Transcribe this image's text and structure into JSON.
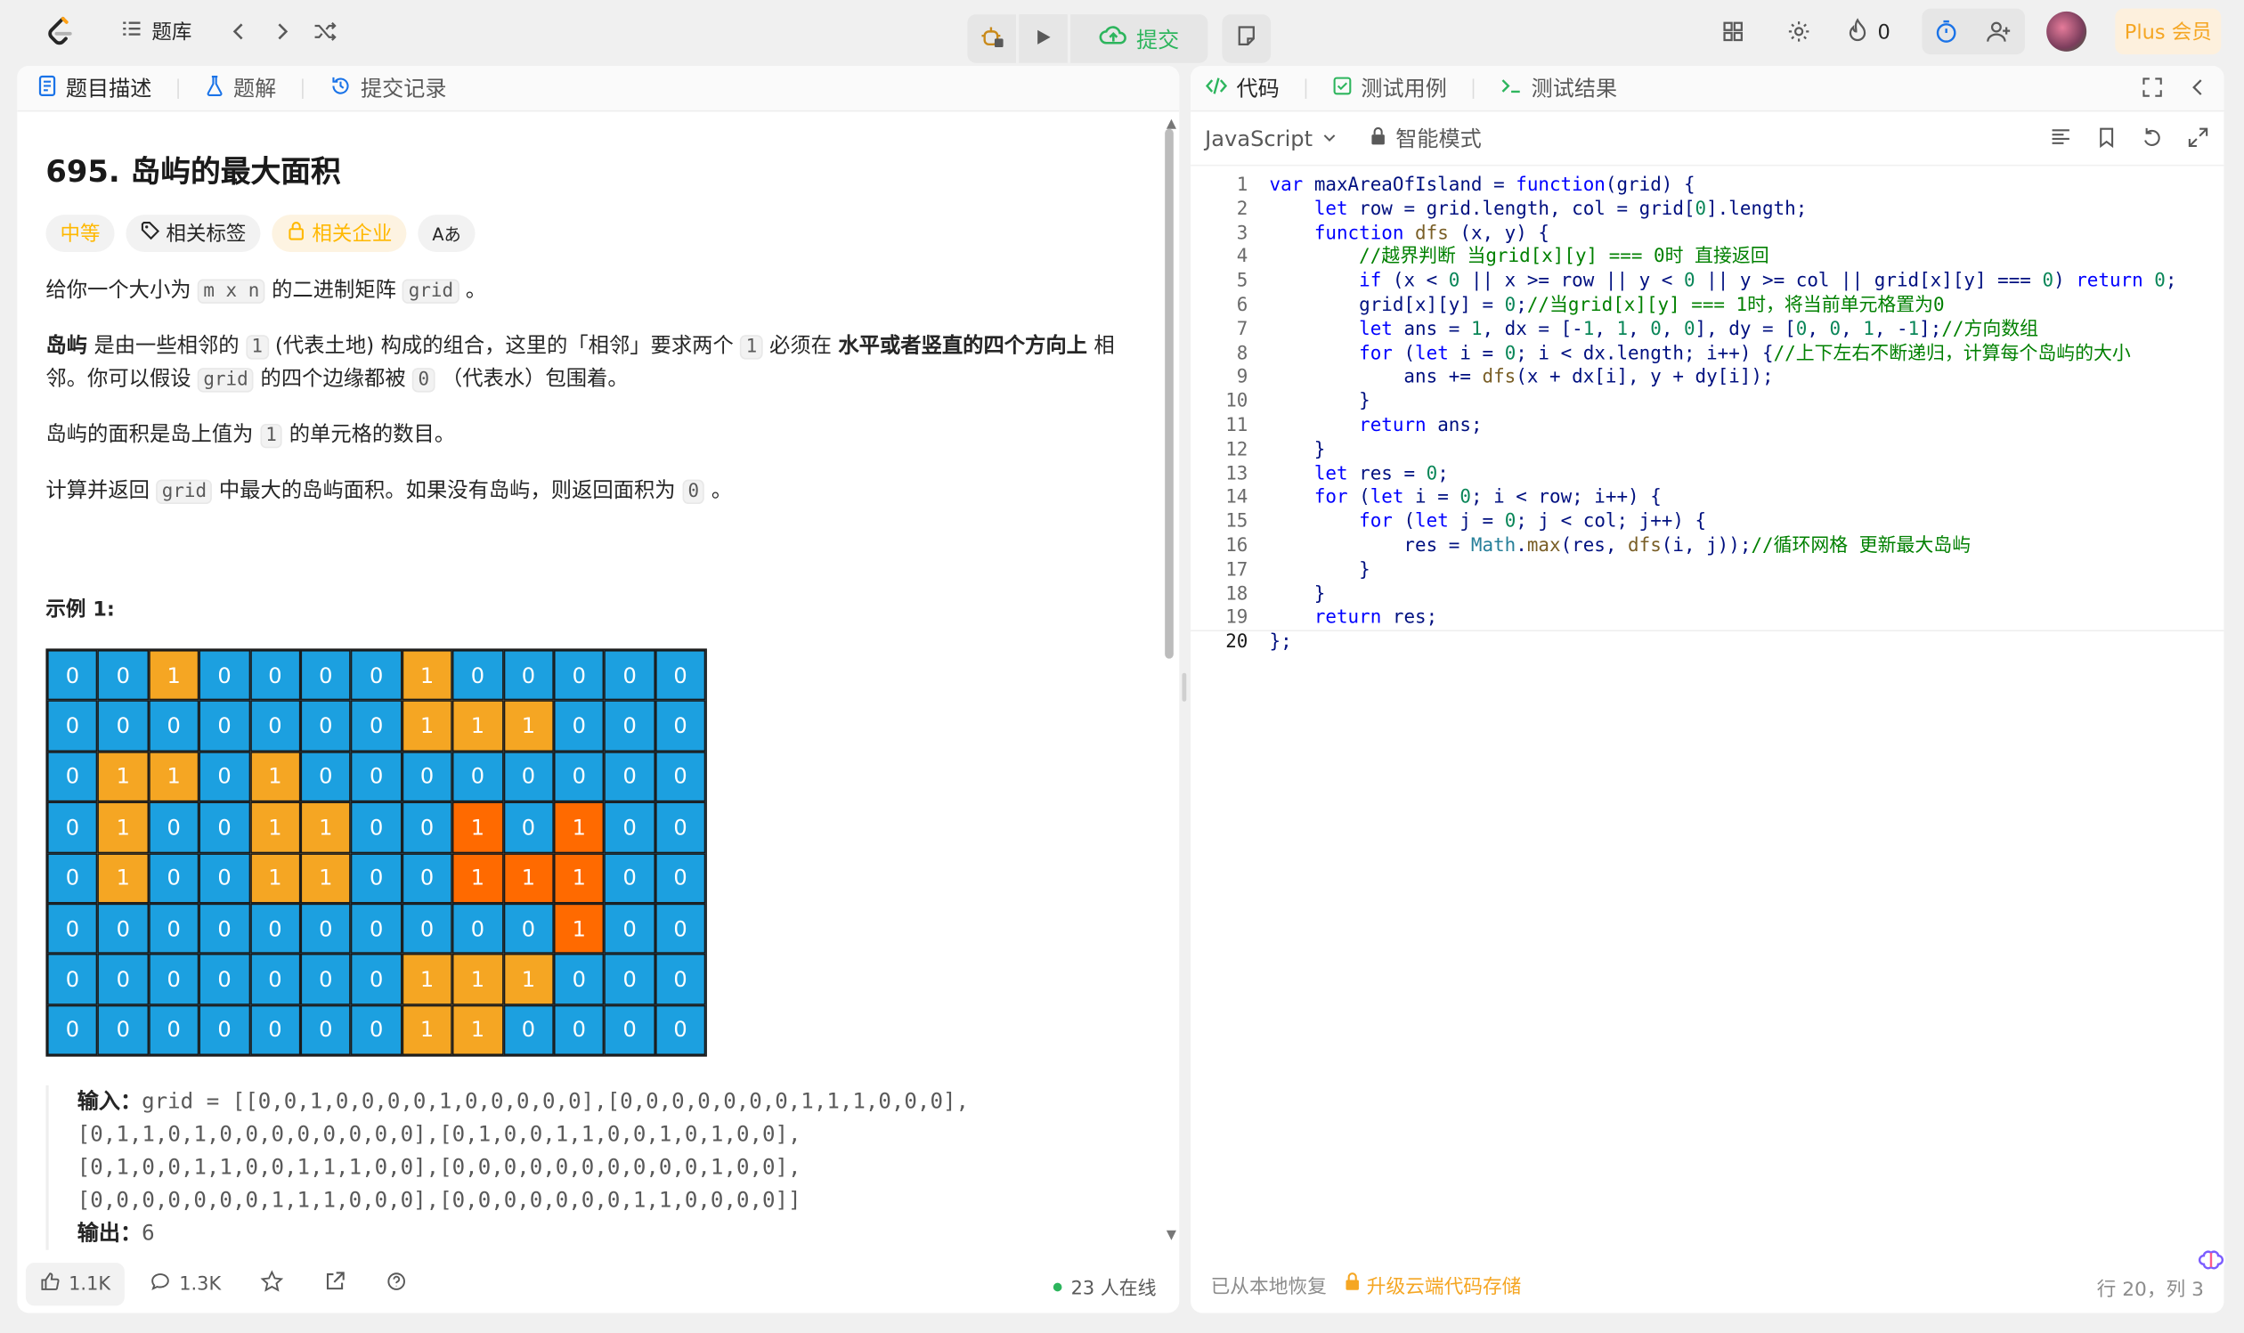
{
  "topbar": {
    "nav_label": "题库",
    "streak_count": "0",
    "plus_label": "Plus 会员",
    "submit_label": "提交"
  },
  "left_tabs": [
    {
      "label": "题目描述"
    },
    {
      "label": "题解"
    },
    {
      "label": "提交记录"
    }
  ],
  "problem": {
    "title": "695. 岛屿的最大面积",
    "difficulty": "中等",
    "tag_label": "相关标签",
    "company_label": "相关企业",
    "translate_icon_label": "Aあ",
    "para1_pre": "给你一个大小为",
    "para1_code1": "m x n",
    "para1_mid": "的二进制矩阵",
    "para1_code2": "grid",
    "para1_post": "。",
    "para2_bold": "岛屿",
    "para2_a": "是由一些相邻的",
    "para2_code1": "1",
    "para2_b": "(代表土地) 构成的组合，这里的「相邻」要求两个",
    "para2_code2": "1",
    "para2_c": "必须在",
    "para2_bold2": "水平或者竖直的四个方向上",
    "para2_d": "相邻。你可以假设",
    "para2_code3": "grid",
    "para2_e": "的四个边缘都被",
    "para2_code4": "0",
    "para2_f": "（代表水）包围着。",
    "para3_a": "岛屿的面积是岛上值为",
    "para3_code": "1",
    "para3_b": "的单元格的数目。",
    "para4_a": "计算并返回",
    "para4_code1": "grid",
    "para4_b": "中最大的岛屿面积。如果没有岛屿，则返回面积为",
    "para4_code2": "0",
    "para4_c": "。",
    "example_title": "示例 1:",
    "grid_values": [
      [
        0,
        0,
        1,
        0,
        0,
        0,
        0,
        1,
        0,
        0,
        0,
        0,
        0
      ],
      [
        0,
        0,
        0,
        0,
        0,
        0,
        0,
        1,
        1,
        1,
        0,
        0,
        0
      ],
      [
        0,
        1,
        1,
        0,
        1,
        0,
        0,
        0,
        0,
        0,
        0,
        0,
        0
      ],
      [
        0,
        1,
        0,
        0,
        1,
        1,
        0,
        0,
        1,
        0,
        1,
        0,
        0
      ],
      [
        0,
        1,
        0,
        0,
        1,
        1,
        0,
        0,
        1,
        1,
        1,
        0,
        0
      ],
      [
        0,
        0,
        0,
        0,
        0,
        0,
        0,
        0,
        0,
        0,
        1,
        0,
        0
      ],
      [
        0,
        0,
        0,
        0,
        0,
        0,
        0,
        1,
        1,
        1,
        0,
        0,
        0
      ],
      [
        0,
        0,
        0,
        0,
        0,
        0,
        0,
        1,
        1,
        0,
        0,
        0,
        0
      ]
    ],
    "grid_highlight": [
      [
        0,
        0,
        1,
        0,
        0,
        0,
        0,
        1,
        0,
        0,
        0,
        0,
        0
      ],
      [
        0,
        0,
        0,
        0,
        0,
        0,
        0,
        1,
        1,
        1,
        0,
        0,
        0
      ],
      [
        0,
        1,
        1,
        0,
        1,
        0,
        0,
        0,
        0,
        0,
        0,
        0,
        0
      ],
      [
        0,
        1,
        0,
        0,
        1,
        1,
        0,
        0,
        2,
        0,
        2,
        0,
        0
      ],
      [
        0,
        1,
        0,
        0,
        1,
        1,
        0,
        0,
        2,
        2,
        2,
        0,
        0
      ],
      [
        0,
        0,
        0,
        0,
        0,
        0,
        0,
        0,
        0,
        0,
        2,
        0,
        0
      ],
      [
        0,
        0,
        0,
        0,
        0,
        0,
        0,
        1,
        1,
        1,
        0,
        0,
        0
      ],
      [
        0,
        0,
        0,
        0,
        0,
        0,
        0,
        1,
        1,
        0,
        0,
        0,
        0
      ]
    ],
    "input_label": "输入：",
    "input_lines": [
      "grid = [[0,0,1,0,0,0,0,1,0,0,0,0,0],[0,0,0,0,0,0,0,1,1,1,0,0,0],",
      "[0,1,1,0,1,0,0,0,0,0,0,0,0],[0,1,0,0,1,1,0,0,1,0,1,0,0],",
      "[0,1,0,0,1,1,0,0,1,1,1,0,0],[0,0,0,0,0,0,0,0,0,0,1,0,0],",
      "[0,0,0,0,0,0,0,1,1,1,0,0,0],[0,0,0,0,0,0,0,1,1,0,0,0,0]]"
    ],
    "output_label": "输出：",
    "output_value": "6"
  },
  "left_footer": {
    "likes": "1.1K",
    "comments": "1.3K",
    "online": "23 人在线"
  },
  "right_tabs": [
    {
      "label": "代码"
    },
    {
      "label": "测试用例"
    },
    {
      "label": "测试结果"
    }
  ],
  "editor": {
    "language": "JavaScript",
    "mode": "智能模式",
    "restore_text": "已从本地恢复",
    "upgrade_text": "升级云端代码存储",
    "cursor_pos": "行 20，列 3"
  },
  "colors": {
    "water": "#1ca0e0",
    "land": "#f5a623",
    "largest_island": "#ff6a00",
    "submit_green": "#2db55d",
    "accent_orange": "#ffb800"
  }
}
